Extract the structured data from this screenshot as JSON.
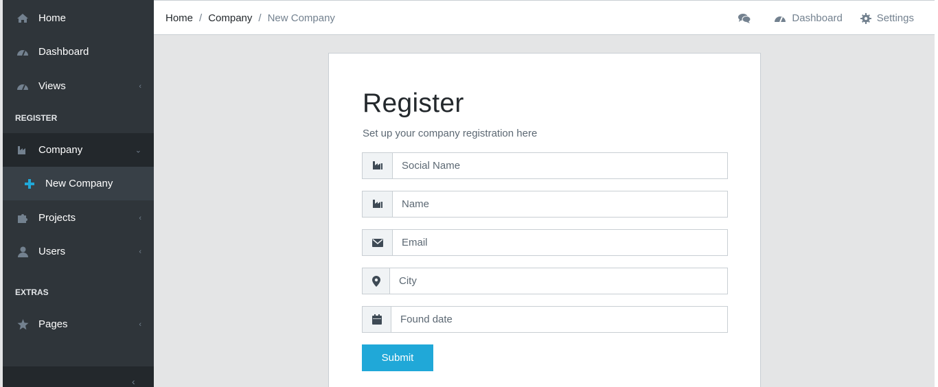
{
  "sidebar": {
    "items": [
      {
        "label": "Home",
        "icon": "home-icon"
      },
      {
        "label": "Dashboard",
        "icon": "speedometer-icon"
      },
      {
        "label": "Views",
        "icon": "speedometer-icon"
      }
    ],
    "section_register": "REGISTER",
    "company": {
      "label": "Company",
      "icon": "industry-icon"
    },
    "new_company": {
      "label": "New Company",
      "icon": "plus-icon"
    },
    "projects": {
      "label": "Projects",
      "icon": "puzzle-icon"
    },
    "users": {
      "label": "Users",
      "icon": "user-icon"
    },
    "section_extras": "EXTRAS",
    "pages": {
      "label": "Pages",
      "icon": "star-icon"
    }
  },
  "header": {
    "breadcrumb": [
      "Home",
      "Company",
      "New Company"
    ],
    "separator": "/",
    "dashboard_label": "Dashboard",
    "settings_label": "Settings"
  },
  "form": {
    "title": "Register",
    "subtitle": "Set up your company registration here",
    "fields": [
      {
        "placeholder": "Social Name",
        "icon": "industry-icon"
      },
      {
        "placeholder": "Name",
        "icon": "industry-icon"
      },
      {
        "placeholder": "Email",
        "icon": "envelope-icon"
      },
      {
        "placeholder": "City",
        "icon": "map-marker-icon"
      },
      {
        "placeholder": "Found date",
        "icon": "calendar-icon"
      }
    ],
    "submit_label": "Submit"
  },
  "colors": {
    "sidebar_bg": "#2f353a",
    "accent": "#20a8d8",
    "page_bg": "#e4e5e6"
  }
}
